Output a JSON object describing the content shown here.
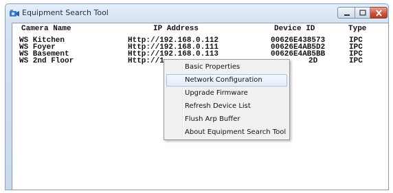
{
  "window": {
    "title": "Equipment Search Tool"
  },
  "table": {
    "headers": [
      "Camera Name",
      "IP Address",
      "Device ID",
      "Type"
    ],
    "rows": [
      [
        "WS Kitchen",
        "Http://192.168.0.112",
        "00626E438573",
        "IPC"
      ],
      [
        "WS Foyer",
        "Http://192.168.0.111",
        "00626E4AB5D2",
        "IPC"
      ],
      [
        "WS Basement",
        "Http://192.168.0.113",
        "00626E4AB5BB",
        "IPC"
      ],
      [
        "WS 2nd Floor",
        "Http://1",
        "2D",
        "IPC"
      ]
    ]
  },
  "context_menu": {
    "items": [
      "Basic Properties",
      "Network Configuration",
      "Upgrade Firmware",
      "Refresh Device List",
      "Flush Arp Buffer",
      "About Equipment Search Tool"
    ],
    "highlighted": "Network Configuration"
  },
  "icons": {
    "app": "camera-icon",
    "minimize": "minimize-icon",
    "maximize": "maximize-icon",
    "close": "close-icon"
  },
  "colors": {
    "titlebar": "#d3e2f2",
    "close_button": "#c8503b",
    "menu_highlight": "#e4edf9"
  }
}
